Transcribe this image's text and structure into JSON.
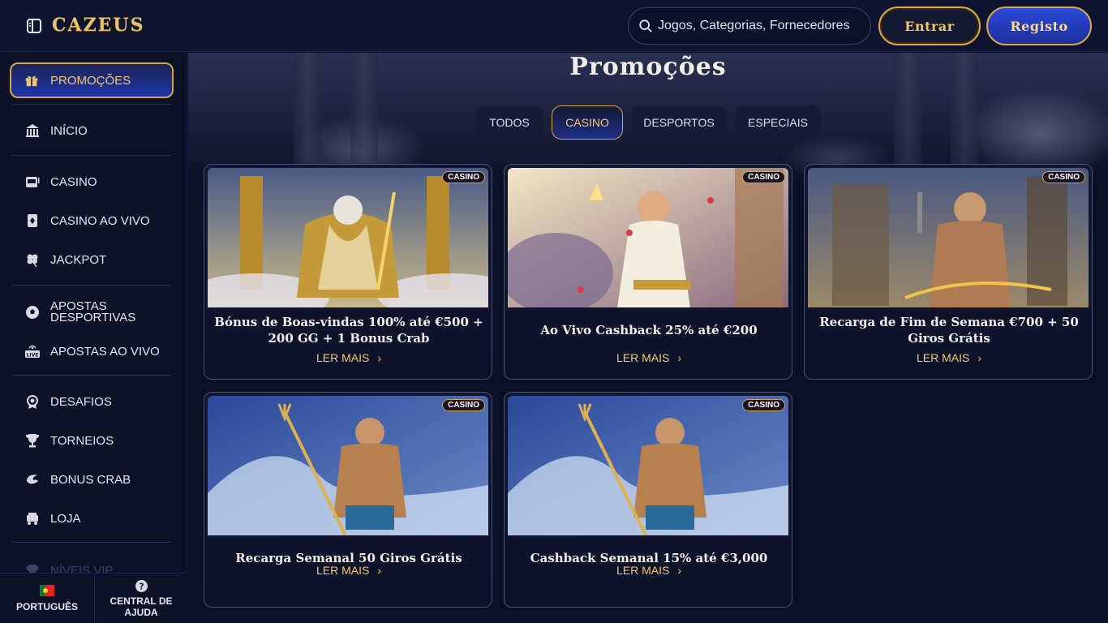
{
  "header": {
    "logo": "CAZEUS",
    "search_placeholder": "Jogos, Categorias, Fornecedores",
    "login_label": "Entrar",
    "register_label": "Registo"
  },
  "sidebar": {
    "promo_label": "PROMOÇÕES",
    "items": [
      {
        "label": "INÍCIO",
        "icon": "bank-icon"
      },
      {
        "label": "CASINO",
        "icon": "slot-icon"
      },
      {
        "label": "CASINO AO VIVO",
        "icon": "cards-icon"
      },
      {
        "label": "JACKPOT",
        "icon": "clover-icon"
      },
      {
        "label": "APOSTAS DESPORTIVAS",
        "icon": "soccer-icon"
      },
      {
        "label": "APOSTAS AO VIVO",
        "icon": "live-icon"
      },
      {
        "label": "DESAFIOS",
        "icon": "medal-icon"
      },
      {
        "label": "TORNEIOS",
        "icon": "trophy-icon"
      },
      {
        "label": "BONUS CRAB",
        "icon": "crab-icon"
      },
      {
        "label": "LOJA",
        "icon": "cart-icon"
      },
      {
        "label": "NÍVEIS VIP",
        "icon": "diamond-icon"
      }
    ],
    "language_label": "PORTUGUÊS",
    "help_label": "CENTRAL DE AJUDA"
  },
  "main": {
    "title": "Promoções",
    "tabs": [
      {
        "label": "TODOS",
        "active": false
      },
      {
        "label": "CASINO",
        "active": true
      },
      {
        "label": "DESPORTOS",
        "active": false
      },
      {
        "label": "ESPECIAIS",
        "active": false
      }
    ],
    "cards": [
      {
        "badge": "CASINO",
        "title": "Bónus de Boas-vindas 100% até €500 + 200 GG + 1 Bonus Crab",
        "more": "LER MAIS"
      },
      {
        "badge": "CASINO",
        "title": "Ao Vivo Cashback 25% até €200",
        "more": "LER MAIS"
      },
      {
        "badge": "CASINO",
        "title": "Recarga de Fim de Semana €700 + 50 Giros Grátis",
        "more": "LER MAIS"
      },
      {
        "badge": "CASINO",
        "title": "Recarga Semanal 50 Giros Grátis",
        "more": "LER MAIS"
      },
      {
        "badge": "CASINO",
        "title": "Cashback Semanal 15% até €3,000",
        "more": "LER MAIS"
      }
    ]
  },
  "colors": {
    "gold": "#d6a545",
    "gold_text": "#f3c76b",
    "background": "#0b1024",
    "accent_blue": "#1e2d86"
  }
}
